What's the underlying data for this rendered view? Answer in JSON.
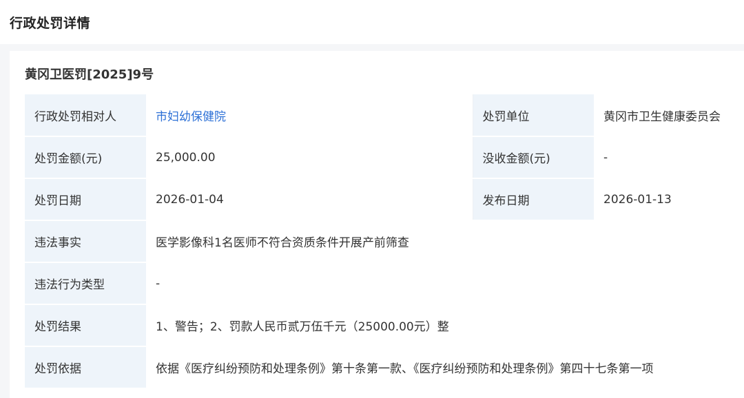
{
  "page": {
    "title": "行政处罚详情"
  },
  "record": {
    "doc_number": "黄冈卫医罚[2025]9号",
    "rows": [
      {
        "label": "行政处罚相对人",
        "value": "市妇幼保健院",
        "label2": "处罚单位",
        "value2": "黄冈市卫生健康委员会"
      },
      {
        "label": "处罚金额(元)",
        "value": "25,000.00",
        "label2": "没收金额(元)",
        "value2": "-"
      },
      {
        "label": "处罚日期",
        "value": "2026-01-04",
        "label2": "发布日期",
        "value2": "2026-01-13"
      },
      {
        "label": "违法事实",
        "value": "医学影像科1名医师不符合资质条件开展产前筛查"
      },
      {
        "label": "违法行为类型",
        "value": "-"
      },
      {
        "label": "处罚结果",
        "value": "1、警告；2、罚款人民币贰万伍千元（25000.00元）整"
      },
      {
        "label": "处罚依据",
        "value": "依据《医疗纠纷预防和处理条例》第十条第一款、《医疗纠纷预防和处理条例》第四十七条第一项"
      }
    ]
  },
  "colors": {
    "label_background": "#eef4fa",
    "link": "#2b6fd6",
    "page_background": "#f5f6f8"
  }
}
